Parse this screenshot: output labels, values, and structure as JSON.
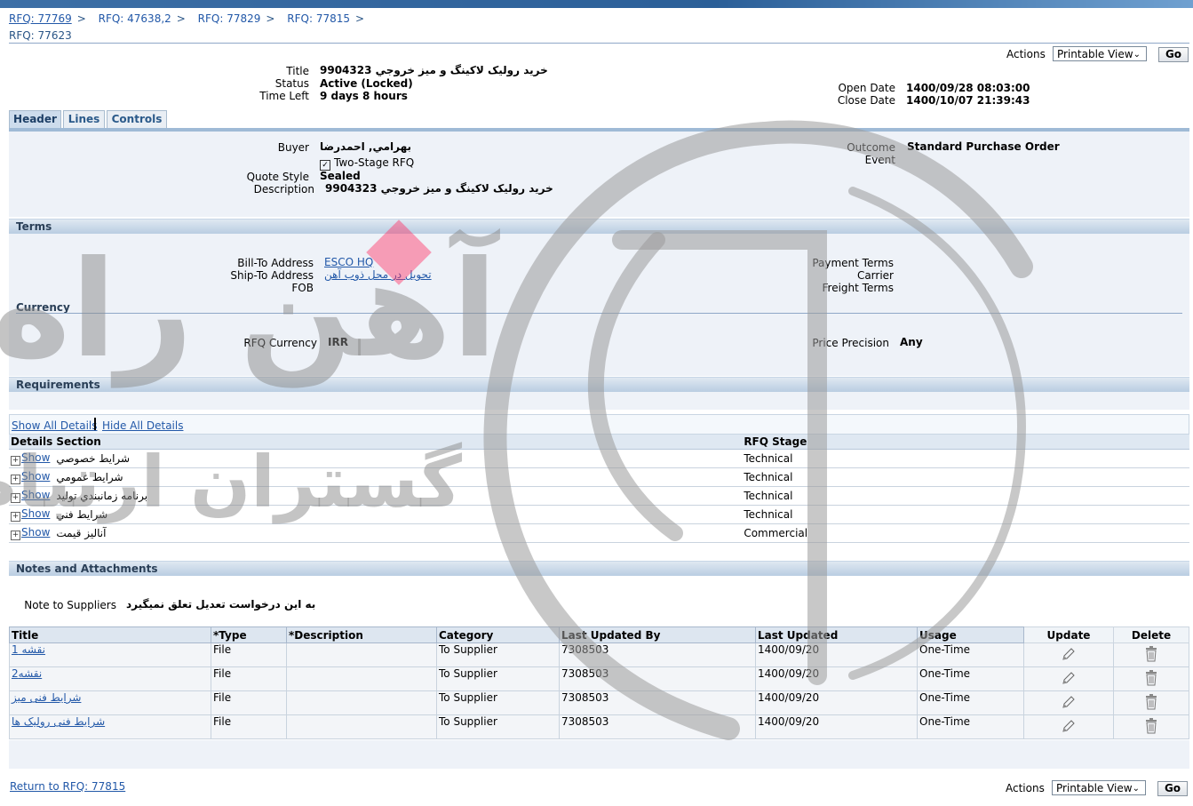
{
  "breadcrumbs": [
    "RFQ: 77769",
    "RFQ: 47638,2",
    "RFQ: 77829",
    "RFQ: 77815"
  ],
  "crumb_separator": ">",
  "page_title": "RFQ: 77623",
  "actions": {
    "label": "Actions",
    "view": "Printable View",
    "go": "Go"
  },
  "summary": {
    "title_label": "Title",
    "title": "خريد رولیک لاکینگ و میز خروجي 9904323",
    "status_label": "Status",
    "status": "Active (Locked)",
    "time_left_label": "Time Left",
    "time_left": "9 days 8 hours",
    "open_date_label": "Open Date",
    "open_date": "1400/09/28 08:03:00",
    "close_date_label": "Close Date",
    "close_date": "1400/10/07 21:39:43"
  },
  "tabs": [
    "Header",
    "Lines",
    "Controls"
  ],
  "header": {
    "buyer_label": "Buyer",
    "buyer": "بهرامي, احمدرضا",
    "two_stage": "Two-Stage RFQ",
    "quote_style_label": "Quote Style",
    "quote_style": "Sealed",
    "description_label": "Description",
    "description": "خريد رولیک لاکینگ و میز خروجي 9904323",
    "outcome_label": "Outcome",
    "outcome": "Standard Purchase Order",
    "event_label": "Event"
  },
  "terms": {
    "section": "Terms",
    "bill_to_label": "Bill-To Address",
    "bill_to": "ESCO HQ",
    "ship_to_label": "Ship-To Address",
    "ship_to": "تحویل در محل ذوب آهن",
    "fob_label": "FOB",
    "payment_terms_label": "Payment Terms",
    "carrier_label": "Carrier",
    "freight_terms_label": "Freight Terms"
  },
  "currency": {
    "section": "Currency",
    "rfq_currency_label": "RFQ Currency",
    "rfq_currency": "IRR",
    "price_precision_label": "Price Precision",
    "price_precision": "Any"
  },
  "requirements": {
    "section": "Requirements",
    "show_all": "Show All Details",
    "hide_all": "Hide All Details",
    "columns": [
      "Details",
      "Section",
      "RFQ Stage"
    ],
    "show_label": "Show",
    "rows": [
      {
        "section": "شرايط خصوصي",
        "stage": "Technical"
      },
      {
        "section": "شرايط عمومي",
        "stage": "Technical"
      },
      {
        "section": "برنامه زمانبندي توليد",
        "stage": "Technical"
      },
      {
        "section": "شرايط فني",
        "stage": "Technical"
      },
      {
        "section": "آناليز قيمت",
        "stage": "Commercial"
      }
    ]
  },
  "notes": {
    "section": "Notes and Attachments",
    "note_label": "Note to Suppliers",
    "note": "به این درخواست تعدیل تعلق نمیگیرد"
  },
  "attachments": {
    "columns": [
      "Title",
      "*Type",
      "*Description",
      "Category",
      "Last Updated By",
      "Last Updated",
      "Usage",
      "Update",
      "Delete"
    ],
    "rows": [
      {
        "title": "نقشه 1",
        "type": "File",
        "description": "",
        "category": "To Supplier",
        "by": "7308503",
        "date": "1400/09/20",
        "usage": "One-Time"
      },
      {
        "title": "نقشه2",
        "type": "File",
        "description": "",
        "category": "To Supplier",
        "by": "7308503",
        "date": "1400/09/20",
        "usage": "One-Time"
      },
      {
        "title": "شرایط فنی میز",
        "type": "File",
        "description": "",
        "category": "To Supplier",
        "by": "7308503",
        "date": "1400/09/20",
        "usage": "One-Time"
      },
      {
        "title": "شرایط فنی رولیک ها",
        "type": "File",
        "description": "",
        "category": "To Supplier",
        "by": "7308503",
        "date": "1400/09/20",
        "usage": "One-Time"
      }
    ]
  },
  "footer": {
    "return_link": "Return to RFQ: 77815"
  },
  "watermark": {
    "text_main": "آهن راه",
    "text_sub": "گستران ارتباط"
  }
}
